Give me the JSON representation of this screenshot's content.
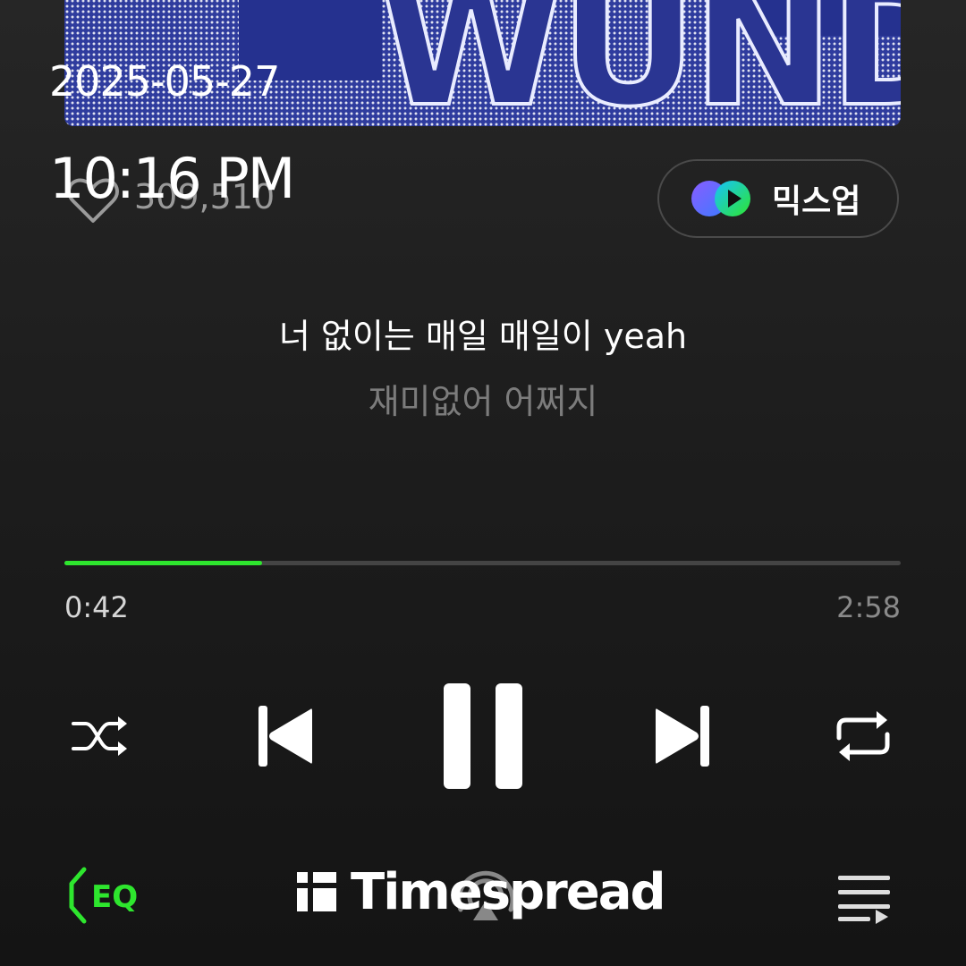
{
  "overlay": {
    "date": "2025-05-27",
    "time": "10:16 PM"
  },
  "album": {
    "art_icon": "album-art"
  },
  "like": {
    "icon": "heart-outline-icon",
    "count": "309,510"
  },
  "mixup": {
    "icon": "mixup-logo-icon",
    "label": "믹스업"
  },
  "lyrics": {
    "current": "너 없이는 매일 매일이 yeah",
    "next": "재미없어 어쩌지"
  },
  "playback": {
    "elapsed": "0:42",
    "total": "2:58",
    "progress": 0.236,
    "accent": "#2ee62e"
  },
  "controls": {
    "shuffle": "shuffle-icon",
    "previous": "skip-previous-icon",
    "play_pause": "pause-icon",
    "next": "skip-next-icon",
    "repeat": "repeat-icon"
  },
  "bottom_bar": {
    "eq_label": "EQ",
    "eq_icon": "eq-speaker-icon",
    "cast_icon": "cast-icon",
    "queue_icon": "playlist-icon",
    "watermark": "Timespread"
  }
}
